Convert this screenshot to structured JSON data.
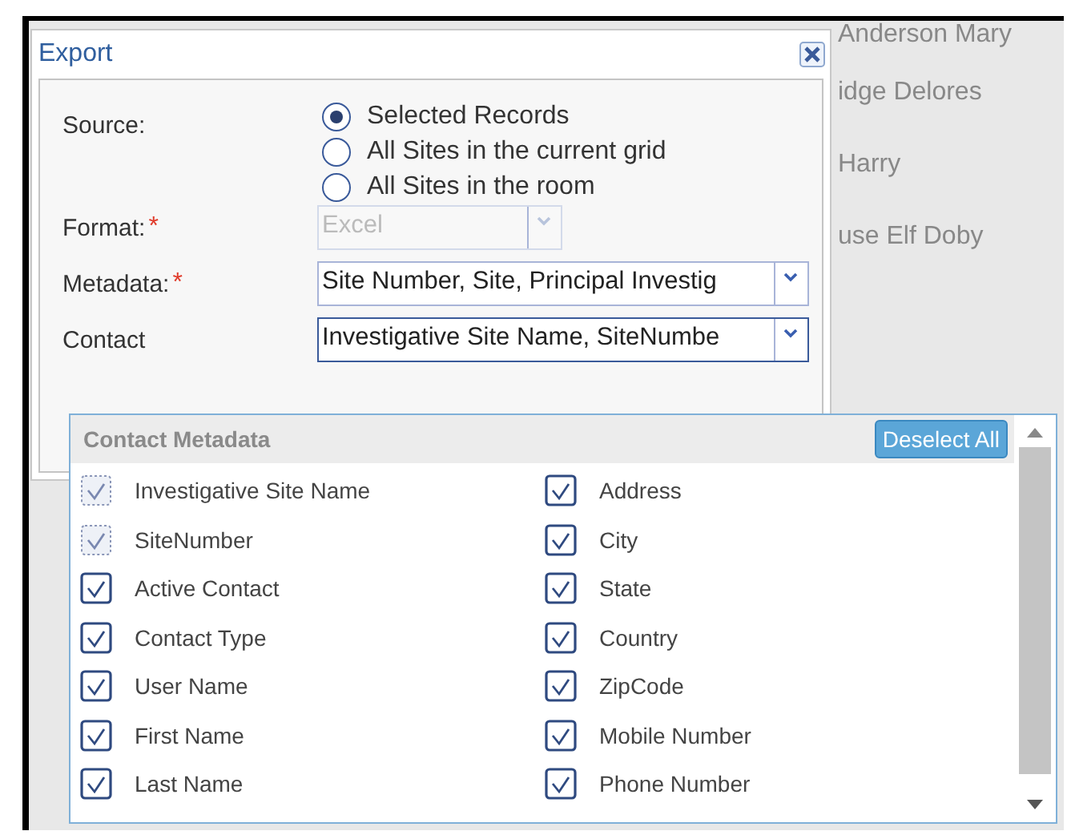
{
  "background_grid": {
    "rows": [
      "Anderson Mary",
      "idge Delores",
      "Harry",
      "use Elf Doby"
    ]
  },
  "dialog": {
    "title": "Export",
    "source": {
      "label": "Source:",
      "options": [
        {
          "label": "Selected Records",
          "selected": true
        },
        {
          "label": "All Sites in the current grid",
          "selected": false
        },
        {
          "label": "All Sites in the room",
          "selected": false
        }
      ]
    },
    "format": {
      "label": "Format:",
      "required_mark": "*",
      "value": "Excel",
      "disabled": true
    },
    "metadata": {
      "label": "Metadata:",
      "required_mark": "*",
      "value": "Site Number, Site, Principal Investig",
      "disabled": false
    },
    "contact_metadata": {
      "label": "Contact",
      "value": "Investigative Site Name, SiteNumbe",
      "disabled": false
    }
  },
  "dropdown": {
    "title": "Contact Metadata",
    "button": "Deselect All",
    "items": [
      {
        "label": "Investigative Site Name",
        "checked": true,
        "disabled": true
      },
      {
        "label": "Address",
        "checked": true,
        "disabled": false
      },
      {
        "label": "SiteNumber",
        "checked": true,
        "disabled": true
      },
      {
        "label": "City",
        "checked": true,
        "disabled": false
      },
      {
        "label": "Active Contact",
        "checked": true,
        "disabled": false
      },
      {
        "label": "State",
        "checked": true,
        "disabled": false
      },
      {
        "label": "Contact Type",
        "checked": true,
        "disabled": false
      },
      {
        "label": "Country",
        "checked": true,
        "disabled": false
      },
      {
        "label": "User Name",
        "checked": true,
        "disabled": false
      },
      {
        "label": "ZipCode",
        "checked": true,
        "disabled": false
      },
      {
        "label": "First Name",
        "checked": true,
        "disabled": false
      },
      {
        "label": "Mobile Number",
        "checked": true,
        "disabled": false
      },
      {
        "label": "Last Name",
        "checked": true,
        "disabled": false
      },
      {
        "label": "Phone Number",
        "checked": true,
        "disabled": false
      }
    ]
  }
}
